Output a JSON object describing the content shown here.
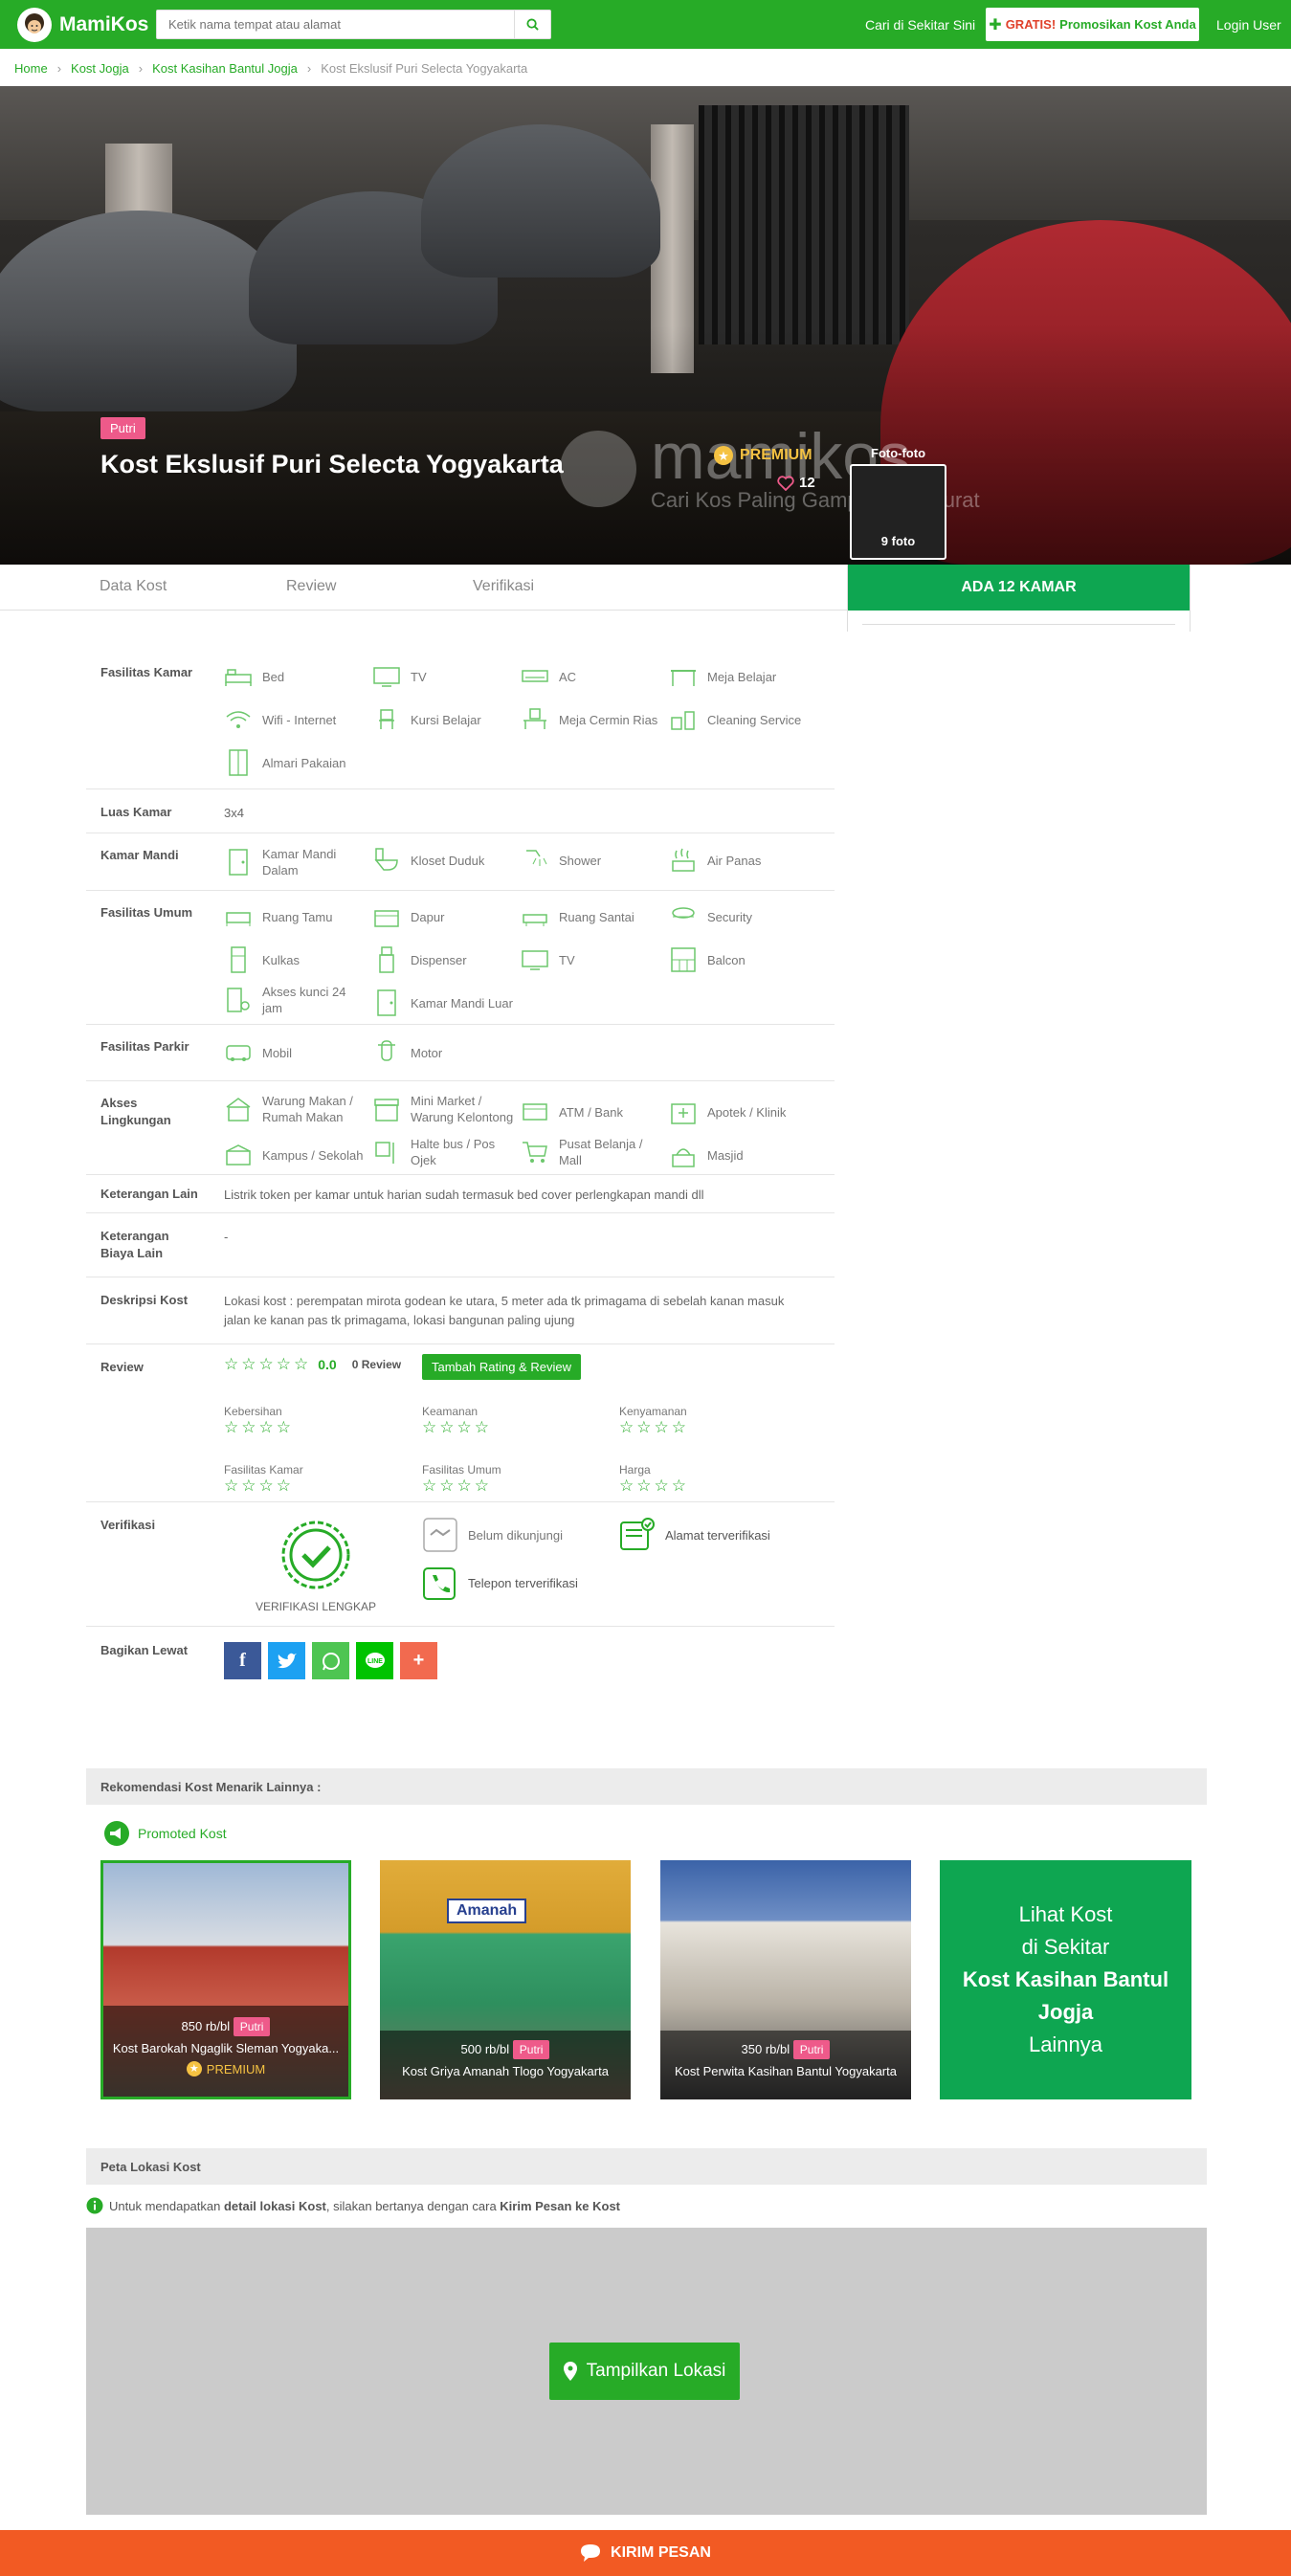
{
  "header": {
    "logo_text": "MamiKos",
    "search_placeholder": "Ketik nama tempat atau alamat",
    "nearby_link": "Cari di Sekitar Sini",
    "promo_free": "GRATIS!",
    "promo_text": "Promosikan Kost Anda",
    "login": "Login User"
  },
  "breadcrumb": [
    "Home",
    "Kost Jogja",
    "Kost Kasihan Bantul Jogja",
    "Kost Ekslusif Puri Selecta Yogyakarta"
  ],
  "hero": {
    "gender_badge": "Putri",
    "title": "Kost Ekslusif Puri Selecta Yogyakarta",
    "premium": "PREMIUM",
    "likes": "12",
    "photos_label": "Foto-foto",
    "photos_count": "9 foto",
    "watermark": "mamikos",
    "watermark_tagline": "Cari Kos Paling Gampang & Akurat"
  },
  "tabs": [
    "Data Kost",
    "Review",
    "Verifikasi"
  ],
  "rooms_button": "ADA 12 KAMAR",
  "details": {
    "fasilitas_kamar": {
      "label": "Fasilitas Kamar",
      "items": [
        "Bed",
        "TV",
        "AC",
        "Meja Belajar",
        "Wifi - Internet",
        "Kursi Belajar",
        "Meja Cermin Rias",
        "Cleaning Service",
        "Almari Pakaian"
      ]
    },
    "luas_kamar": {
      "label": "Luas Kamar",
      "value": "3x4"
    },
    "kamar_mandi": {
      "label": "Kamar Mandi",
      "items": [
        "Kamar Mandi Dalam",
        "Kloset Duduk",
        "Shower",
        "Air Panas"
      ]
    },
    "fasilitas_umum": {
      "label": "Fasilitas Umum",
      "items": [
        "Ruang Tamu",
        "Dapur",
        "Ruang Santai",
        "Security",
        "Kulkas",
        "Dispenser",
        "TV",
        "Balcon",
        "Akses kunci 24 jam",
        "Kamar Mandi Luar"
      ]
    },
    "fasilitas_parkir": {
      "label": "Fasilitas Parkir",
      "items": [
        "Mobil",
        "Motor"
      ]
    },
    "akses_lingkungan": {
      "label": "Akses Lingkungan",
      "items": [
        "Warung Makan / Rumah Makan",
        "Mini Market / Warung Kelontong",
        "ATM / Bank",
        "Apotek / Klinik",
        "Kampus / Sekolah",
        "Halte bus / Pos Ojek",
        "Pusat Belanja / Mall",
        "Masjid"
      ]
    },
    "keterangan_lain": {
      "label": "Keterangan Lain",
      "value": "Listrik token per kamar untuk harian sudah termasuk bed cover perlengkapan mandi dll"
    },
    "keterangan_biaya": {
      "label": "Keterangan Biaya Lain",
      "value": "-"
    },
    "deskripsi": {
      "label": "Deskripsi Kost",
      "line1": "Lokasi kost : perempatan mirota godean ke utara, 5 meter ada tk primagama di sebelah kanan masuk",
      "line2": "jalan ke kanan pas tk primagama, lokasi bangunan paling ujung"
    }
  },
  "review": {
    "label": "Review",
    "score": "0.0",
    "count": "0 Review",
    "add_button": "Tambah Rating & Review",
    "stars_filled": 0,
    "stars_total": 5,
    "categories": [
      "Kebersihan",
      "Keamanan",
      "Kenyamanan",
      "Fasilitas Kamar",
      "Fasilitas Umum",
      "Harga"
    ]
  },
  "verification": {
    "label": "Verifikasi",
    "badge": "VERIFIKASI LENGKAP",
    "visit": "Belum dikunjungi",
    "address": "Alamat terverifikasi",
    "phone": "Telepon terverifikasi"
  },
  "share": {
    "label": "Bagikan Lewat",
    "targets": [
      "facebook",
      "twitter",
      "whatsapp",
      "line",
      "more"
    ]
  },
  "recommend": {
    "header": "Rekomendasi Kost Menarik Lainnya :",
    "promoted": "Promoted Kost",
    "cards": [
      {
        "price": "850 rb/bl",
        "gender": "Putri",
        "name": "Kost Barokah Ngaglik Sleman Yogyaka...",
        "premium": "PREMIUM"
      },
      {
        "price": "500 rb/bl",
        "gender": "Putri",
        "name": "Kost Griya Amanah Tlogo Yogyakarta",
        "sign": "Amanah"
      },
      {
        "price": "350 rb/bl",
        "gender": "Putri",
        "name": "Kost Perwita Kasihan Bantul Yogyakarta"
      }
    ],
    "more": {
      "l1": "Lihat Kost",
      "l2": "di Sekitar",
      "l3": "Kost Kasihan Bantul",
      "l4": "Jogja",
      "l5": "Lainnya"
    }
  },
  "map": {
    "header": "Peta Lokasi Kost",
    "info_pre": "Untuk mendapatkan ",
    "info_bold1": "detail lokasi Kost",
    "info_mid": ", silakan bertanya dengan cara ",
    "info_bold2": "Kirim Pesan ke Kost",
    "button": "Tampilkan Lokasi"
  },
  "footer": {
    "send": "KIRIM PESAN"
  },
  "colors": {
    "brand": "#27ab27",
    "accent_green": "#0ea651",
    "pink": "#ee5a8a",
    "orange": "#f25a23",
    "gold": "#f5c242"
  }
}
